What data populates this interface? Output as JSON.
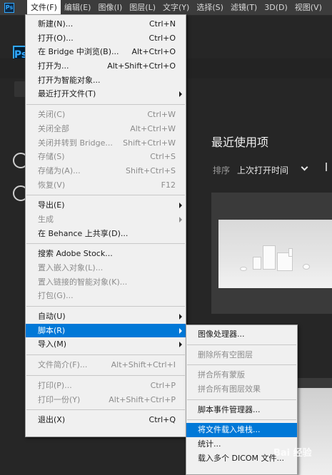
{
  "menubar": {
    "app_icon": "Ps",
    "items": [
      {
        "label": "文件(F)"
      },
      {
        "label": "编辑(E)"
      },
      {
        "label": "图像(I)"
      },
      {
        "label": "图层(L)"
      },
      {
        "label": "文字(Y)"
      },
      {
        "label": "选择(S)"
      },
      {
        "label": "滤镜(T)"
      },
      {
        "label": "3D(D)"
      },
      {
        "label": "视图(V)"
      }
    ]
  },
  "home": {
    "logo": "Ps",
    "recent_title": "最近使用项",
    "sort_label": "排序",
    "sort_value": "上次打开时间"
  },
  "file_menu": {
    "items": [
      {
        "label": "新建(N)...",
        "shortcut": "Ctrl+N"
      },
      {
        "label": "打开(O)...",
        "shortcut": "Ctrl+O"
      },
      {
        "label": "在 Bridge 中浏览(B)...",
        "shortcut": "Alt+Ctrl+O"
      },
      {
        "label": "打开为...",
        "shortcut": "Alt+Shift+Ctrl+O"
      },
      {
        "label": "打开为智能对象..."
      },
      {
        "label": "最近打开文件(T)"
      },
      {
        "label": "关闭(C)",
        "shortcut": "Ctrl+W"
      },
      {
        "label": "关闭全部",
        "shortcut": "Alt+Ctrl+W"
      },
      {
        "label": "关闭并转到 Bridge...",
        "shortcut": "Shift+Ctrl+W"
      },
      {
        "label": "存储(S)",
        "shortcut": "Ctrl+S"
      },
      {
        "label": "存储为(A)...",
        "shortcut": "Shift+Ctrl+S"
      },
      {
        "label": "恢复(V)",
        "shortcut": "F12"
      },
      {
        "label": "导出(E)"
      },
      {
        "label": "生成"
      },
      {
        "label": "在 Behance 上共享(D)..."
      },
      {
        "label": "搜索 Adobe Stock..."
      },
      {
        "label": "置入嵌入对象(L)..."
      },
      {
        "label": "置入链接的智能对象(K)..."
      },
      {
        "label": "打包(G)..."
      },
      {
        "label": "自动(U)"
      },
      {
        "label": "脚本(R)"
      },
      {
        "label": "导入(M)"
      },
      {
        "label": "文件简介(F)...",
        "shortcut": "Alt+Shift+Ctrl+I"
      },
      {
        "label": "打印(P)...",
        "shortcut": "Ctrl+P"
      },
      {
        "label": "打印一份(Y)",
        "shortcut": "Alt+Shift+Ctrl+P"
      },
      {
        "label": "退出(X)",
        "shortcut": "Ctrl+Q"
      }
    ]
  },
  "scripts_submenu": {
    "items": [
      {
        "label": "图像处理器..."
      },
      {
        "label": "删除所有空图层"
      },
      {
        "label": "拼合所有蒙版"
      },
      {
        "label": "拼合所有图层效果"
      },
      {
        "label": "脚本事件管理器..."
      },
      {
        "label": "将文件载入堆栈..."
      },
      {
        "label": "统计..."
      },
      {
        "label": "载入多个 DICOM 文件..."
      }
    ]
  },
  "watermark": "Bai 经验"
}
